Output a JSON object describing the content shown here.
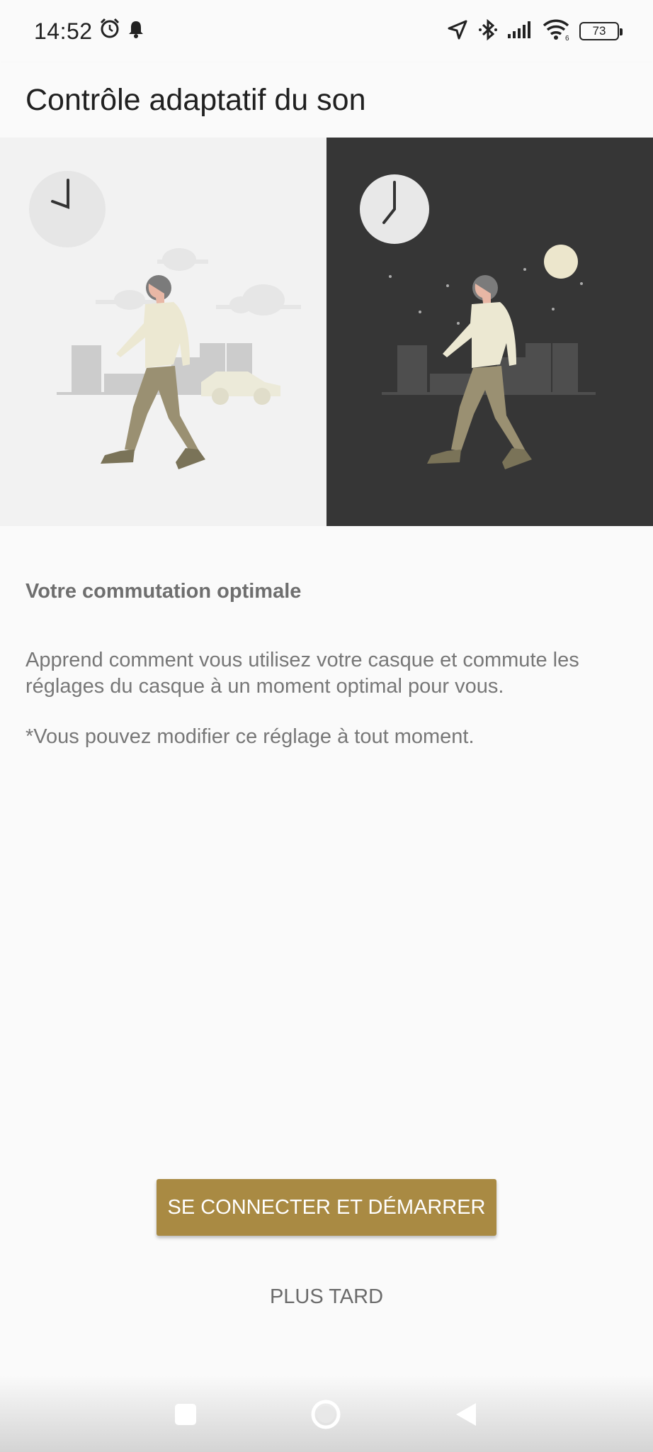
{
  "status_bar": {
    "time": "14:52",
    "battery": "73",
    "icons": [
      "alarm-icon",
      "notification-bell-icon",
      "location-arrow-icon",
      "bluetooth-icon",
      "signal-icon",
      "wifi-6-icon",
      "battery-icon"
    ]
  },
  "header": {
    "title": "Contrôle adaptatif du son"
  },
  "illustration": {
    "panels": [
      "day-scene",
      "night-scene"
    ]
  },
  "content": {
    "subtitle": "Votre commutation optimale",
    "description": "Apprend comment vous utilisez votre casque et commute les réglages du casque à un moment optimal pour vous.",
    "note": "*Vous pouvez modifier ce réglage à tout moment."
  },
  "actions": {
    "primary_label": "SE CONNECTER ET DÉMARRER",
    "secondary_label": "PLUS TARD"
  },
  "colors": {
    "accent": "#a98a43",
    "night_background": "#363636",
    "day_background": "#f2f2f2"
  },
  "nav_bar": {
    "buttons": [
      "recents-square-icon",
      "home-circle-icon",
      "back-triangle-icon"
    ]
  }
}
